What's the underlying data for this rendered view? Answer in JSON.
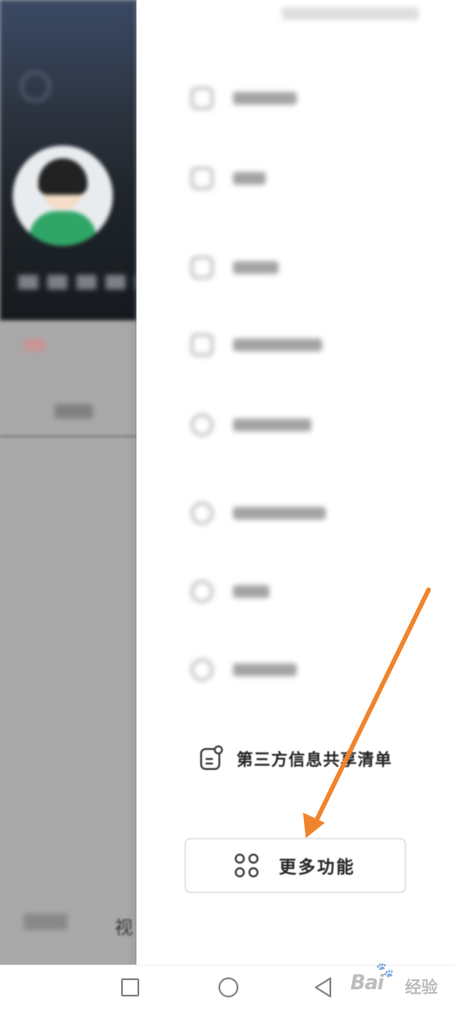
{
  "left_page": {
    "bottom_tab_label": "视"
  },
  "drawer": {
    "blurred_items": [
      {
        "icon": "bag-icon",
        "label": ""
      },
      {
        "icon": "moon-icon",
        "label": ""
      },
      {
        "icon": "scan-icon",
        "label": ""
      },
      {
        "icon": "calendar-icon",
        "label": ""
      },
      {
        "icon": "creator-icon",
        "label": ""
      },
      {
        "icon": "help-icon",
        "label": ""
      },
      {
        "icon": "settings-icon",
        "label": ""
      },
      {
        "icon": "wallet-icon",
        "label": ""
      }
    ],
    "third_party": {
      "icon": "document-icon",
      "label": "第三方信息共享清单"
    },
    "more_button": {
      "icon": "grid-icon",
      "label": "更多功能"
    }
  },
  "annotation": {
    "arrow_color": "#f0842c"
  },
  "nav_bar": {
    "buttons": [
      "recent-apps",
      "home",
      "back"
    ]
  },
  "watermark": {
    "text": "Bai",
    "suffix": "经验"
  }
}
